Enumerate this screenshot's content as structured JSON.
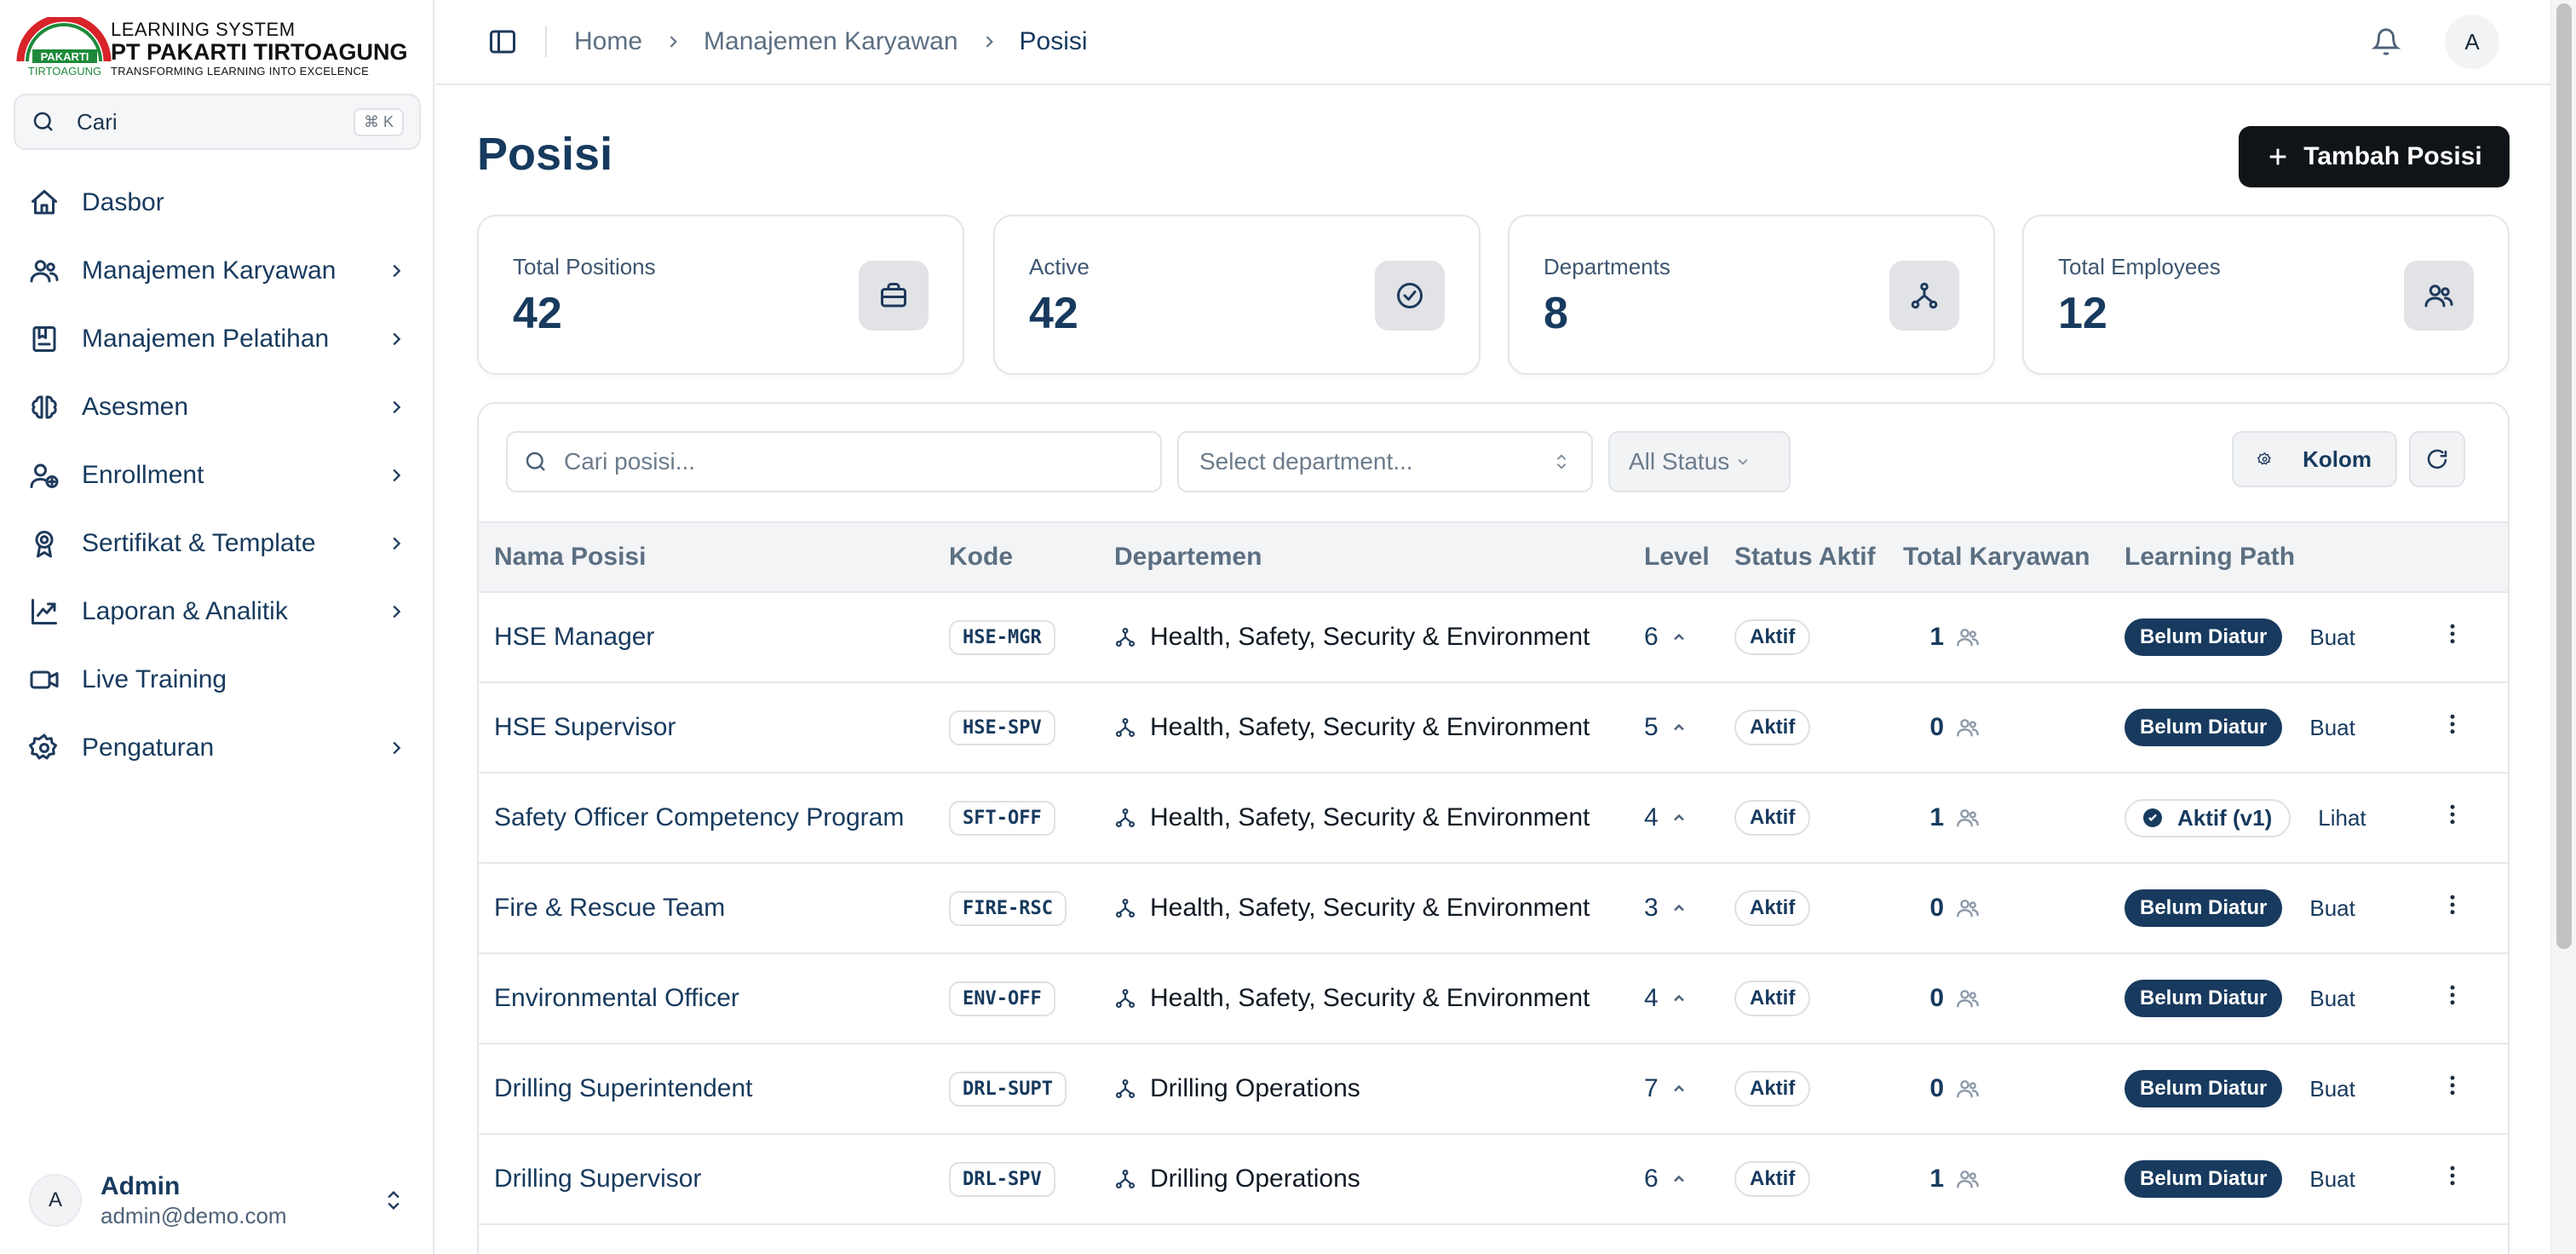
{
  "brand": {
    "line1": "LEARNING SYSTEM",
    "line2": "PT PAKARTI TIRTOAGUNG",
    "line3": "TRANSFORMING LEARNING INTO EXCELENCE",
    "mark_top": "PAKARTI",
    "mark_bottom": "TIRTOAGUNG",
    "colors": {
      "red": "#d8232a",
      "green": "#1d8a3a"
    }
  },
  "sidebar": {
    "search_label": "Cari",
    "search_shortcut": "⌘ K",
    "items": [
      {
        "label": "Dasbor",
        "icon": "home-icon",
        "has_children": false
      },
      {
        "label": "Manajemen Karyawan",
        "icon": "users-icon",
        "has_children": true
      },
      {
        "label": "Manajemen Pelatihan",
        "icon": "book-icon",
        "has_children": true
      },
      {
        "label": "Asesmen",
        "icon": "brain-icon",
        "has_children": true
      },
      {
        "label": "Enrollment",
        "icon": "user-plus-icon",
        "has_children": true
      },
      {
        "label": "Sertifikat & Template",
        "icon": "award-icon",
        "has_children": true
      },
      {
        "label": "Laporan & Analitik",
        "icon": "trending-up-icon",
        "has_children": true
      },
      {
        "label": "Live Training",
        "icon": "video-icon",
        "has_children": false
      },
      {
        "label": "Pengaturan",
        "icon": "gear-icon",
        "has_children": true
      }
    ],
    "user": {
      "initial": "A",
      "name": "Admin",
      "email": "admin@demo.com"
    }
  },
  "header": {
    "breadcrumbs": [
      "Home",
      "Manajemen Karyawan",
      "Posisi"
    ],
    "avatar_initial": "A"
  },
  "page": {
    "title": "Posisi",
    "add_button": "Tambah Posisi"
  },
  "stats": [
    {
      "label": "Total Positions",
      "value": "42",
      "icon": "briefcase-icon"
    },
    {
      "label": "Active",
      "value": "42",
      "icon": "check-circle-icon"
    },
    {
      "label": "Departments",
      "value": "8",
      "icon": "network-icon"
    },
    {
      "label": "Total Employees",
      "value": "12",
      "icon": "users-icon"
    }
  ],
  "filters": {
    "search_placeholder": "Cari posisi...",
    "department_placeholder": "Select department...",
    "status_value": "All Status",
    "columns_button": "Kolom"
  },
  "table": {
    "columns": [
      "Nama Posisi",
      "Kode",
      "Departemen",
      "Level",
      "Status Aktif",
      "Total Karyawan",
      "Learning Path"
    ],
    "rows": [
      {
        "name": "HSE Manager",
        "code": "HSE-MGR",
        "dept": "Health, Safety, Security & Environment",
        "level": "6",
        "status": "Aktif",
        "total": "1",
        "lp_state": "unset",
        "lp_label": "Belum Diatur",
        "lp_action": "Buat"
      },
      {
        "name": "HSE Supervisor",
        "code": "HSE-SPV",
        "dept": "Health, Safety, Security & Environment",
        "level": "5",
        "status": "Aktif",
        "total": "0",
        "lp_state": "unset",
        "lp_label": "Belum Diatur",
        "lp_action": "Buat"
      },
      {
        "name": "Safety Officer Competency Program",
        "code": "SFT-OFF",
        "dept": "Health, Safety, Security & Environment",
        "level": "4",
        "status": "Aktif",
        "total": "1",
        "lp_state": "active",
        "lp_label": "Aktif (v1)",
        "lp_action": "Lihat"
      },
      {
        "name": "Fire & Rescue Team",
        "code": "FIRE-RSC",
        "dept": "Health, Safety, Security & Environment",
        "level": "3",
        "status": "Aktif",
        "total": "0",
        "lp_state": "unset",
        "lp_label": "Belum Diatur",
        "lp_action": "Buat"
      },
      {
        "name": "Environmental Officer",
        "code": "ENV-OFF",
        "dept": "Health, Safety, Security & Environment",
        "level": "4",
        "status": "Aktif",
        "total": "0",
        "lp_state": "unset",
        "lp_label": "Belum Diatur",
        "lp_action": "Buat"
      },
      {
        "name": "Drilling Superintendent",
        "code": "DRL-SUPT",
        "dept": "Drilling Operations",
        "level": "7",
        "status": "Aktif",
        "total": "0",
        "lp_state": "unset",
        "lp_label": "Belum Diatur",
        "lp_action": "Buat"
      },
      {
        "name": "Drilling Supervisor",
        "code": "DRL-SPV",
        "dept": "Drilling Operations",
        "level": "6",
        "status": "Aktif",
        "total": "1",
        "lp_state": "unset",
        "lp_label": "Belum Diatur",
        "lp_action": "Buat"
      }
    ]
  }
}
